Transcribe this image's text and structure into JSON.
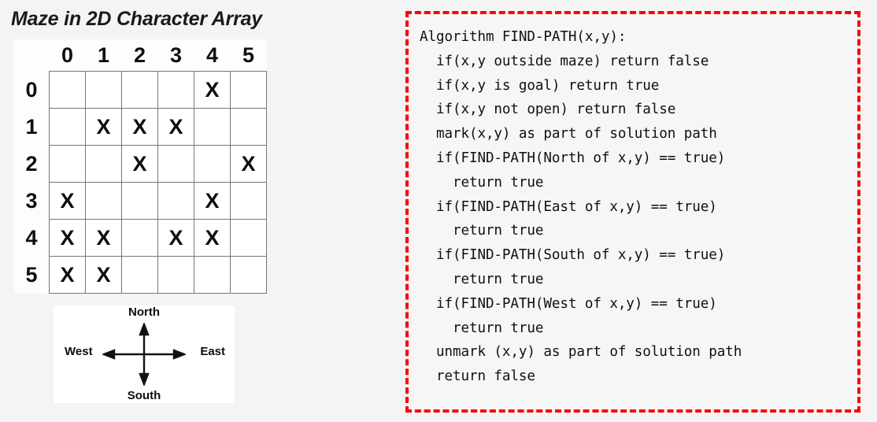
{
  "left_panel": {
    "title": "Maze in 2D Character Array",
    "maze": {
      "column_headers": [
        "0",
        "1",
        "2",
        "3",
        "4",
        "5"
      ],
      "row_headers": [
        "0",
        "1",
        "2",
        "3",
        "4",
        "5"
      ],
      "wall_symbol": "X",
      "rows": [
        [
          "",
          "",
          "",
          "",
          "X",
          ""
        ],
        [
          "",
          "X",
          "X",
          "X",
          "",
          ""
        ],
        [
          "",
          "",
          "X",
          "",
          "",
          "X"
        ],
        [
          "X",
          "",
          "",
          "",
          "X",
          ""
        ],
        [
          "X",
          "X",
          "",
          "X",
          "X",
          ""
        ],
        [
          "X",
          "X",
          "",
          "",
          "",
          ""
        ]
      ]
    },
    "compass": {
      "north": "North",
      "south": "South",
      "east": "East",
      "west": "West"
    }
  },
  "algorithm": {
    "border_color": "#ff0000",
    "heading": "Algorithm FIND-PATH(x,y):",
    "lines": [
      "Algorithm FIND-PATH(x,y):",
      "  if(x,y outside maze) return false",
      "  if(x,y is goal) return true",
      "  if(x,y not open) return false",
      "  mark(x,y) as part of solution path",
      "  if(FIND-PATH(North of x,y) == true)",
      "    return true",
      "  if(FIND-PATH(East of x,y) == true)",
      "    return true",
      "  if(FIND-PATH(South of x,y) == true)",
      "    return true",
      "  if(FIND-PATH(West of x,y) == true)",
      "    return true",
      "  unmark (x,y) as part of solution path",
      "  return false"
    ]
  }
}
